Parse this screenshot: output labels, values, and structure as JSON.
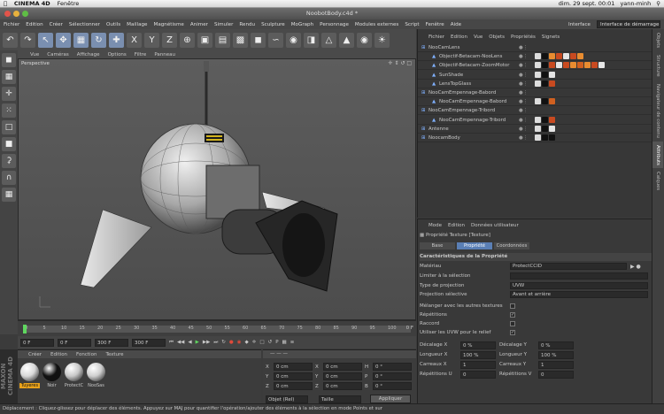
{
  "mac": {
    "app": "CINEMA 4D",
    "menu": "Fenêtre",
    "time": "dim. 29 sept. 00:01",
    "user": "yann-minh"
  },
  "window": {
    "title": "NoobotBody.c4d *"
  },
  "menubar": {
    "items": [
      "Fichier",
      "Edition",
      "Créer",
      "Sélectionner",
      "Outils",
      "Maillage",
      "Magnétisme",
      "Animer",
      "Simuler",
      "Rendu",
      "Sculpture",
      "MoGraph",
      "Personnage",
      "Modules externes",
      "Script",
      "Fenêtre",
      "Aide"
    ],
    "interface_label": "Interface",
    "layout": "Interface de démarrage"
  },
  "toolbar": {
    "icons": [
      "undo-icon",
      "redo-icon",
      "select-icon",
      "move-icon",
      "scale-icon",
      "rotate-icon",
      "live-select-icon",
      "x-axis-icon",
      "y-axis-icon",
      "z-axis-icon",
      "world-icon",
      "render-view-icon",
      "render-icon",
      "render-settings-icon",
      "cube-icon",
      "spline-icon",
      "nurbs-icon",
      "array-icon",
      "deformer-icon",
      "scene-icon",
      "camera-icon",
      "light-icon"
    ]
  },
  "viewport": {
    "menu": [
      "Vue",
      "Caméras",
      "Affichage",
      "Options",
      "Filtre",
      "Panneau"
    ],
    "label": "Perspective"
  },
  "timeline": {
    "ticks": [
      "0",
      "5",
      "10",
      "15",
      "20",
      "25",
      "30",
      "35",
      "40",
      "45",
      "50",
      "55",
      "60",
      "65",
      "70",
      "75",
      "80",
      "85",
      "90",
      "95",
      "100"
    ],
    "end_label": "0 F"
  },
  "transport": {
    "start": "0 F",
    "current": "0 F",
    "end": "300 F",
    "end2": "300 F"
  },
  "materials": {
    "menu": [
      "Créer",
      "Edition",
      "Fonction",
      "Texture"
    ],
    "items": [
      {
        "name": "Tuyeres",
        "color": "#d8d8d8"
      },
      {
        "name": "Noir",
        "color": "#111111"
      },
      {
        "name": "ProtectC",
        "color": "#c8c8c8"
      },
      {
        "name": "NooSas",
        "color": "#cfcfcf"
      }
    ]
  },
  "coords": {
    "rows": [
      {
        "axis": "X",
        "pos": "0 cm",
        "size": "0 cm",
        "rot_label": "H",
        "rot": "0 °"
      },
      {
        "axis": "Y",
        "pos": "0 cm",
        "size": "0 cm",
        "rot_label": "P",
        "rot": "0 °"
      },
      {
        "axis": "Z",
        "pos": "0 cm",
        "size": "0 cm",
        "rot_label": "B",
        "rot": "0 °"
      }
    ],
    "mode1": "Objet (Rel)",
    "mode2": "Taille",
    "apply": "Appliquer"
  },
  "objects": {
    "menu": [
      "Fichier",
      "Edition",
      "Vue",
      "Objets",
      "Propriétés",
      "Signets"
    ],
    "rows": [
      {
        "name": "NooCamLens",
        "indent": 0
      },
      {
        "name": "Objectif-Betacam-NooLens",
        "indent": 2
      },
      {
        "name": "Objectif-Betacam-ZoomMotor",
        "indent": 2
      },
      {
        "name": "SunShade",
        "indent": 2
      },
      {
        "name": "LensTopGlass",
        "indent": 2
      },
      {
        "name": "NooCamEmpennage-Babord",
        "indent": 0
      },
      {
        "name": "NooCamEmpennage-Babord",
        "indent": 2
      },
      {
        "name": "NooCamEmpennage-Tribord",
        "indent": 0
      },
      {
        "name": "NooCamEmpennage-Tribord",
        "indent": 2
      },
      {
        "name": "Antenne",
        "indent": 0
      },
      {
        "name": "NoocamBody",
        "indent": 0
      }
    ]
  },
  "attributes": {
    "menu": [
      "Mode",
      "Edition",
      "Données utilisateur"
    ],
    "header": "Propriété Texture [Texture]",
    "tabs": [
      "Base",
      "Propriété",
      "Coordonnées"
    ],
    "section": "Caractéristiques de la Propriété",
    "material_label": "Matériau",
    "material_value": "ProtectCCID",
    "limit_label": "Limiter à la sélection",
    "projection_label": "Type de projection",
    "projection_value": "UVW",
    "side_label": "Projection sélective",
    "side_value": "Avant et arrière",
    "mix_label": "Mélanger avec les autres textures",
    "tile_label": "Répétitions",
    "seam_label": "Raccord",
    "uvw_label": "Utiliser les UVW pour le relief",
    "params": [
      {
        "l": "Décalage X",
        "v": "0 %",
        "l2": "Décalage Y",
        "v2": "0 %"
      },
      {
        "l": "Longueur X",
        "v": "100 %",
        "l2": "Longueur Y",
        "v2": "100 %"
      },
      {
        "l": "Carreaux X",
        "v": "1",
        "l2": "Carreaux Y",
        "v2": "1"
      },
      {
        "l": "Répétitions U",
        "v": "0",
        "l2": "Répétitions V",
        "v2": "0"
      }
    ]
  },
  "righttabs": [
    "Objets",
    "Structure",
    "Navigateur de contenu",
    "Attributs",
    "Calques"
  ],
  "status": "Déplacement : Cliquez-glissez pour déplacer des éléments. Appuyez sur MAJ pour quantifier l'opération/ajouter des éléments à la sélection en mode Points et sur"
}
